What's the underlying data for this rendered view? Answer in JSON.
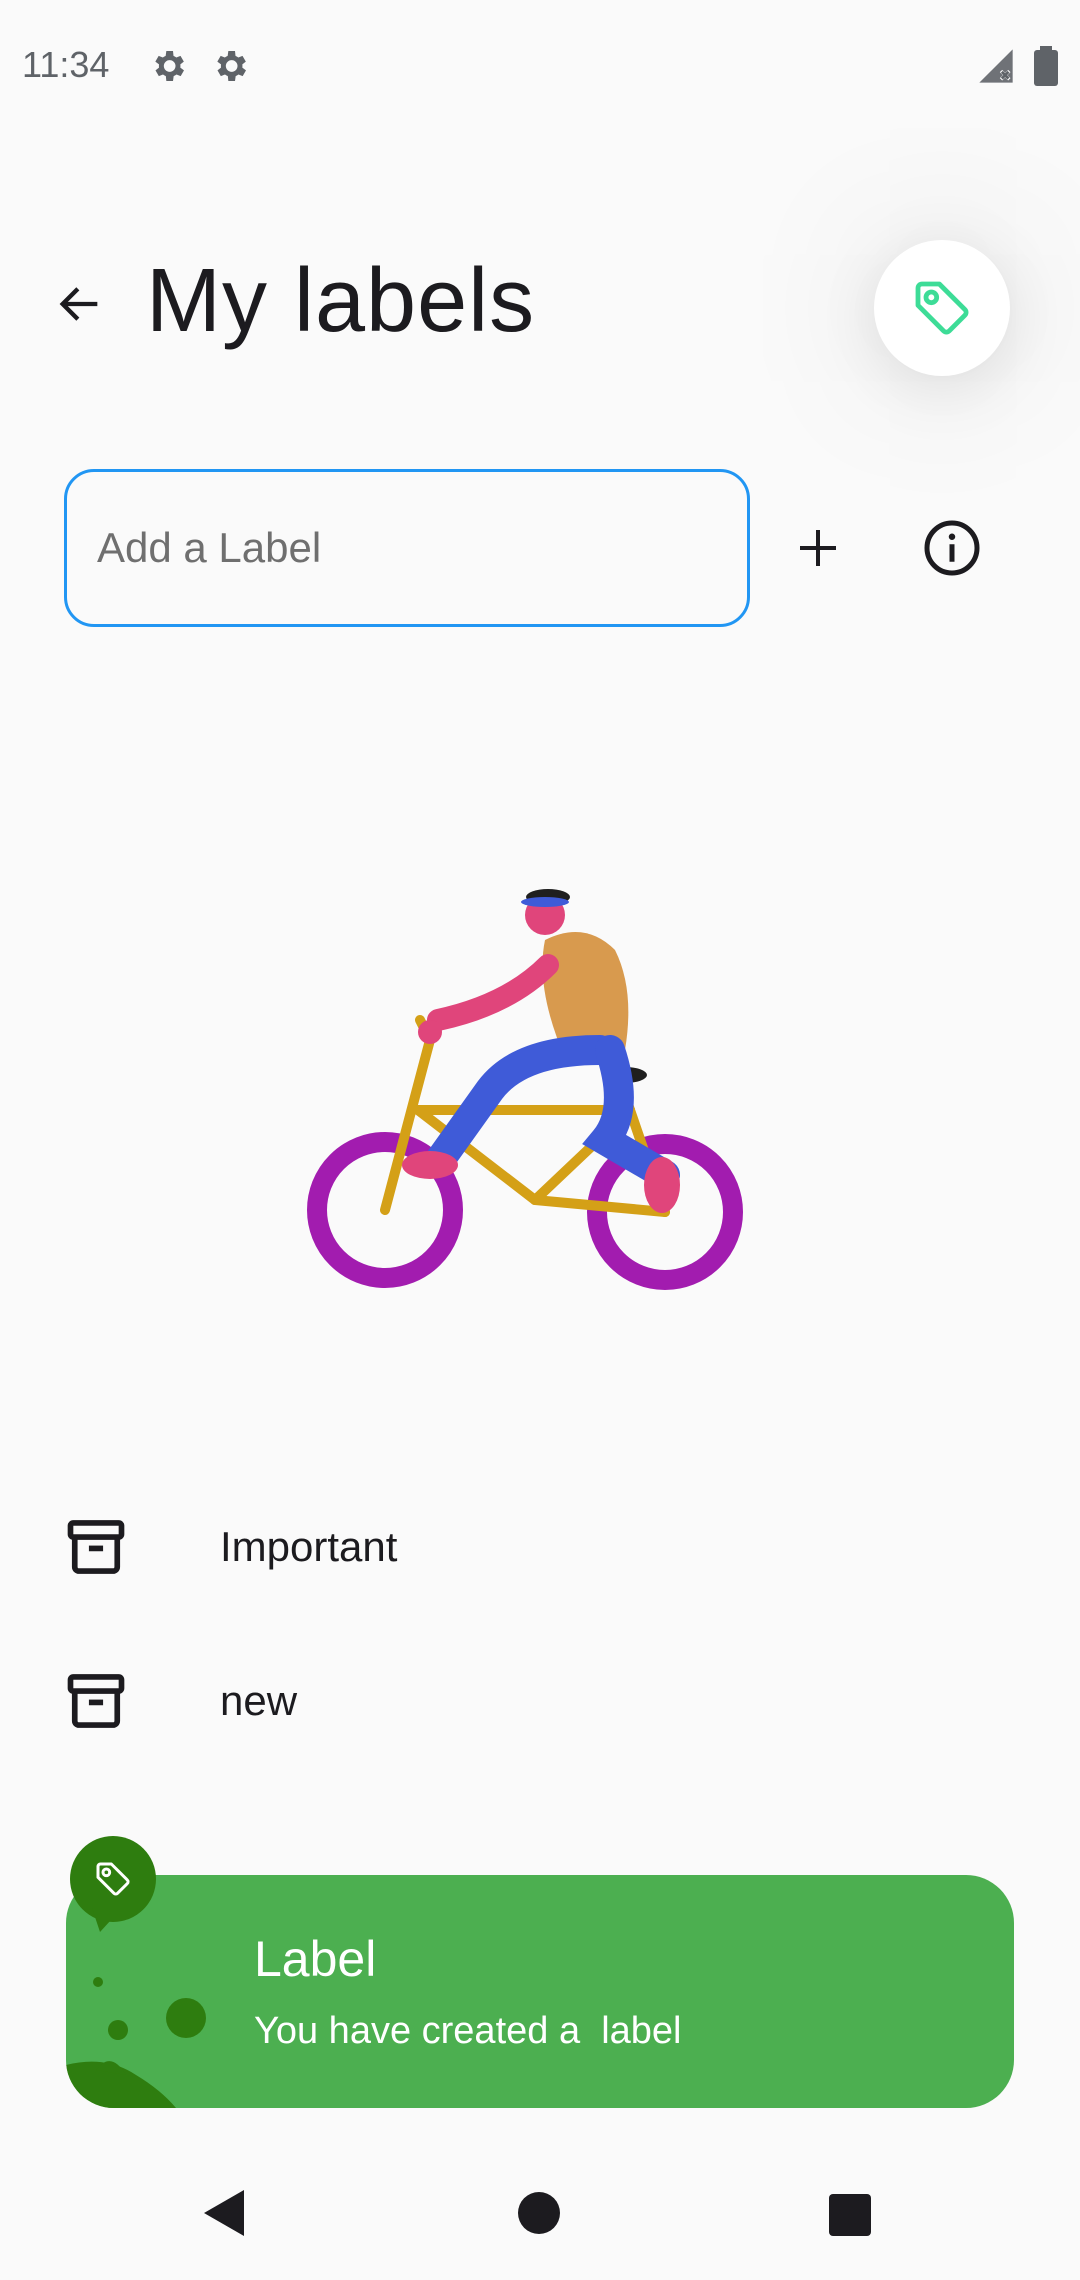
{
  "status_bar": {
    "time": "11:34",
    "icons": [
      "settings-gear-icon",
      "settings-gear-icon",
      "no-signal-icon",
      "battery-icon"
    ]
  },
  "header": {
    "title": "My labels",
    "back_icon": "arrow-back-icon",
    "fab_icon": "tag-icon",
    "fab_color": "#3DDC97"
  },
  "label_input": {
    "placeholder": "Add a Label",
    "value": "",
    "border_color": "#2196F3"
  },
  "actions": {
    "add_icon": "plus-icon",
    "info_icon": "info-icon"
  },
  "illustration": "person-riding-bicycle",
  "labels": [
    {
      "name": "Important",
      "icon": "archive-icon"
    },
    {
      "name": "new",
      "icon": "archive-icon"
    }
  ],
  "snackbar": {
    "title": "Label",
    "message": "You have created a  label",
    "icon": "tag-icon",
    "background": "#4CAF50"
  },
  "nav": {
    "back": "nav-back-icon",
    "home": "nav-home-icon",
    "recents": "nav-recents-icon"
  }
}
